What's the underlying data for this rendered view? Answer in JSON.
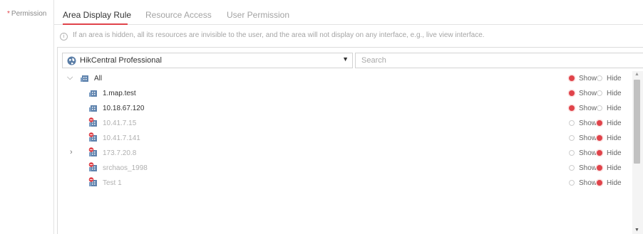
{
  "left_label": {
    "required_mark": "*",
    "text": "Permission"
  },
  "tabs": [
    {
      "label": "Area Display Rule",
      "active": true
    },
    {
      "label": "Resource Access",
      "active": false
    },
    {
      "label": "User Permission",
      "active": false
    }
  ],
  "info": {
    "icon": "info-icon",
    "text": "If an area is hidden, all its resources are invisible to the user, and the area will not display on any interface, e.g., live view interface."
  },
  "site_select": {
    "value": "HikCentral Professional",
    "icon": "globe-icon"
  },
  "search": {
    "placeholder": "Search",
    "value": ""
  },
  "tree": {
    "show_label": "Show",
    "hide_label": "Hide",
    "rows": [
      {
        "label": "All",
        "expander": "down",
        "icon": "area-icon",
        "state": "show",
        "offline": false
      },
      {
        "label": "1.map.test",
        "expander": "",
        "icon": "area-icon",
        "state": "show",
        "offline": false
      },
      {
        "label": "10.18.67.120",
        "expander": "",
        "icon": "area-icon",
        "state": "show",
        "offline": false
      },
      {
        "label": "10.41.7.15",
        "expander": "",
        "icon": "area-offline-icon",
        "state": "hide",
        "offline": true
      },
      {
        "label": "10.41.7.141",
        "expander": "",
        "icon": "area-offline-icon",
        "state": "hide",
        "offline": true
      },
      {
        "label": "173.7.20.8",
        "expander": "right",
        "icon": "area-offline-icon",
        "state": "hide",
        "offline": true
      },
      {
        "label": "srchaos_1998",
        "expander": "",
        "icon": "area-offline-icon",
        "state": "hide",
        "offline": true
      },
      {
        "label": "Test 1",
        "expander": "",
        "icon": "area-offline-icon",
        "state": "hide",
        "offline": true
      }
    ]
  },
  "colors": {
    "accent": "#e0434a",
    "muted_text": "#b0b0b0",
    "border": "#dcdcdc"
  }
}
